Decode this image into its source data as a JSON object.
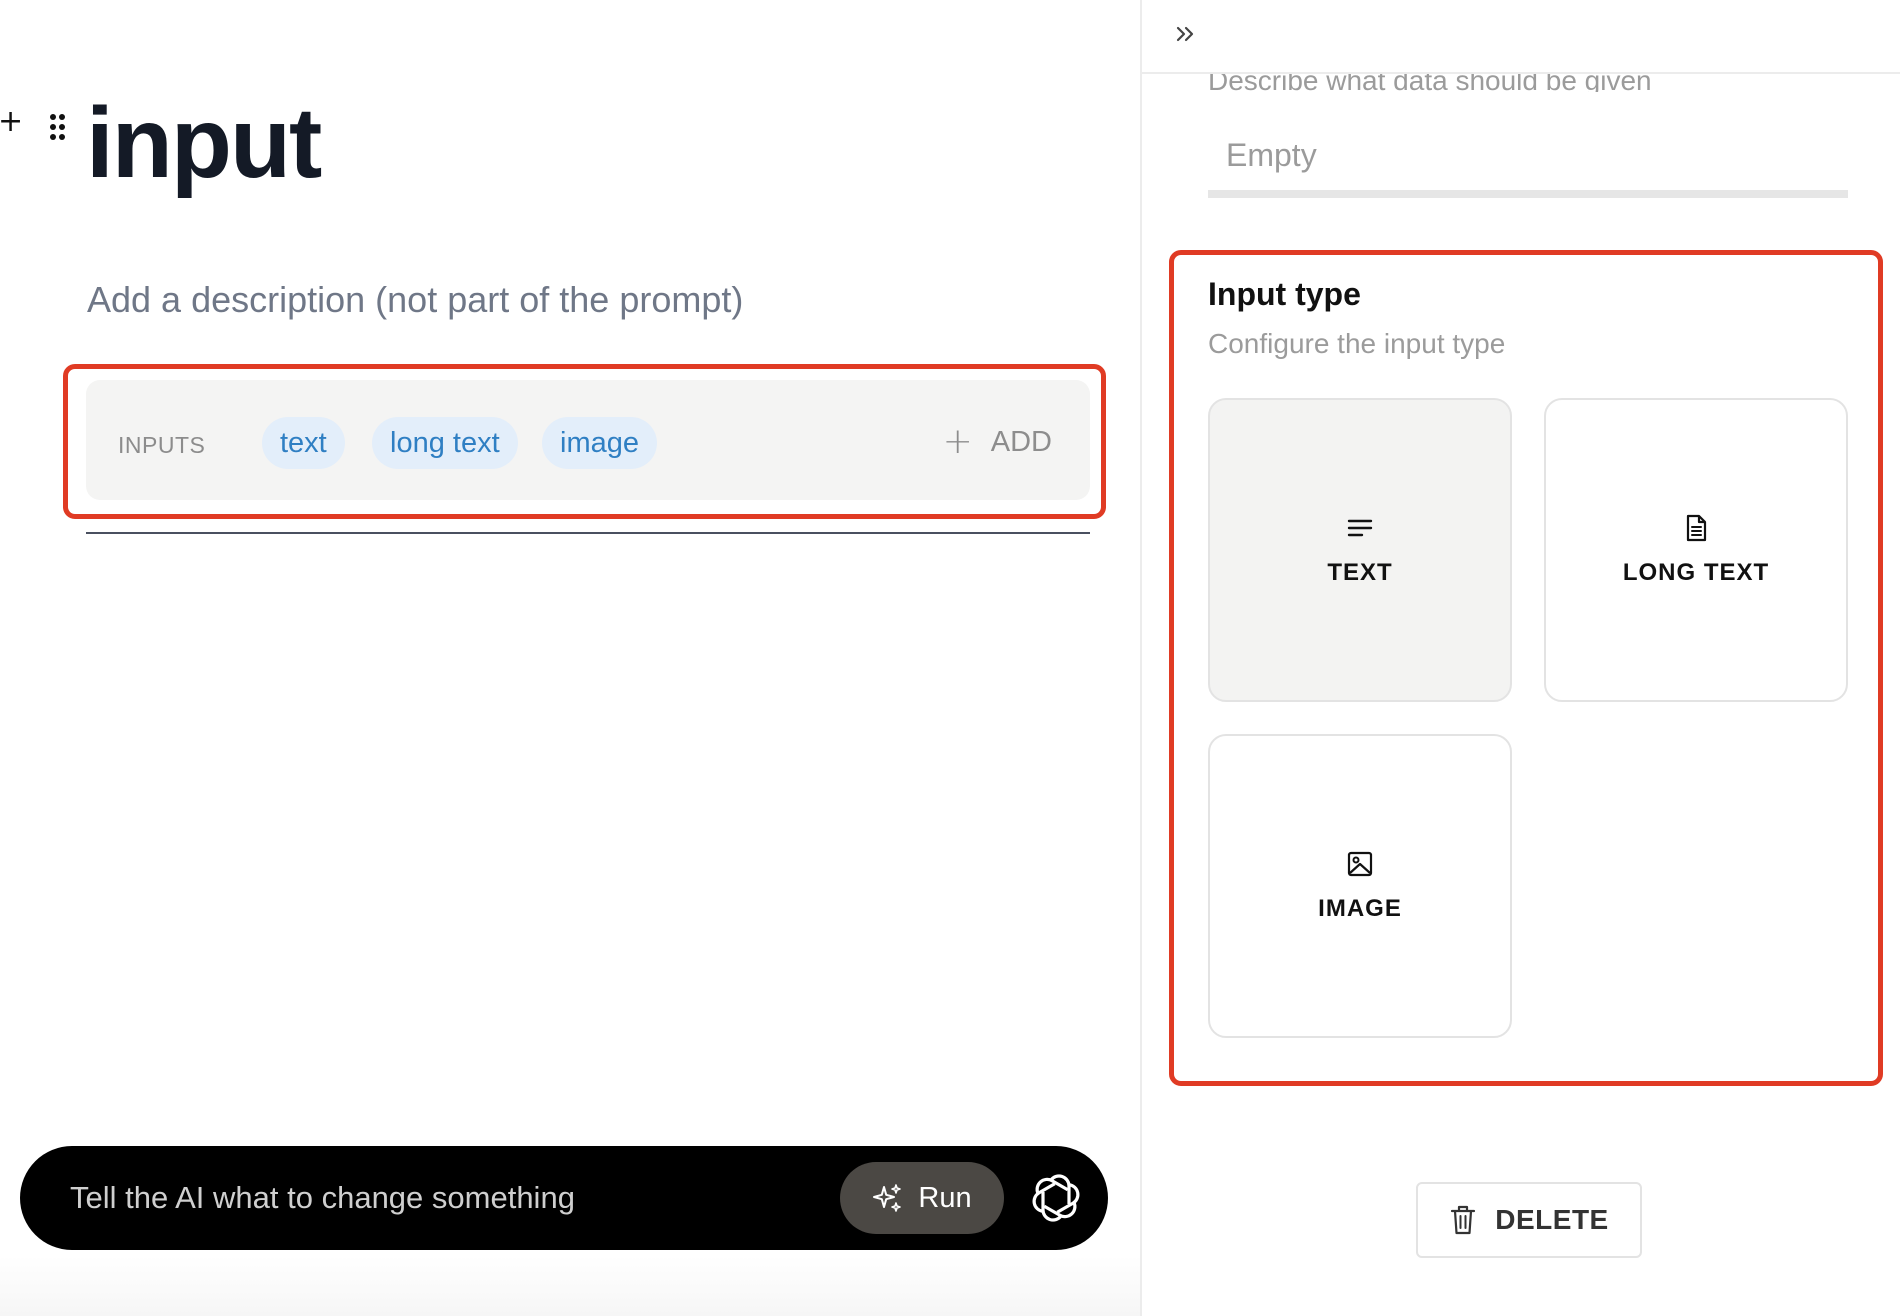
{
  "editor": {
    "title": "input",
    "description_placeholder": "Add a description (not part of the prompt)",
    "inputs": {
      "label": "INPUTS",
      "chips": [
        "text",
        "long text",
        "image"
      ],
      "add_label": "ADD"
    },
    "ai_bar": {
      "placeholder": "Tell the AI what to change something",
      "run_label": "Run"
    }
  },
  "panel": {
    "field_description_help": "Describe what data should be given",
    "field_description_placeholder": "Empty",
    "input_type": {
      "title": "Input type",
      "subtitle": "Configure the input type",
      "options": [
        {
          "label": "TEXT",
          "icon": "text-lines-icon",
          "selected": true
        },
        {
          "label": "LONG TEXT",
          "icon": "document-icon",
          "selected": false
        },
        {
          "label": "IMAGE",
          "icon": "image-icon",
          "selected": false
        }
      ]
    },
    "delete_label": "DELETE"
  },
  "colors": {
    "highlight": "#e03b24",
    "chip_bg": "#e3eefa",
    "chip_text": "#2f7fc3"
  }
}
